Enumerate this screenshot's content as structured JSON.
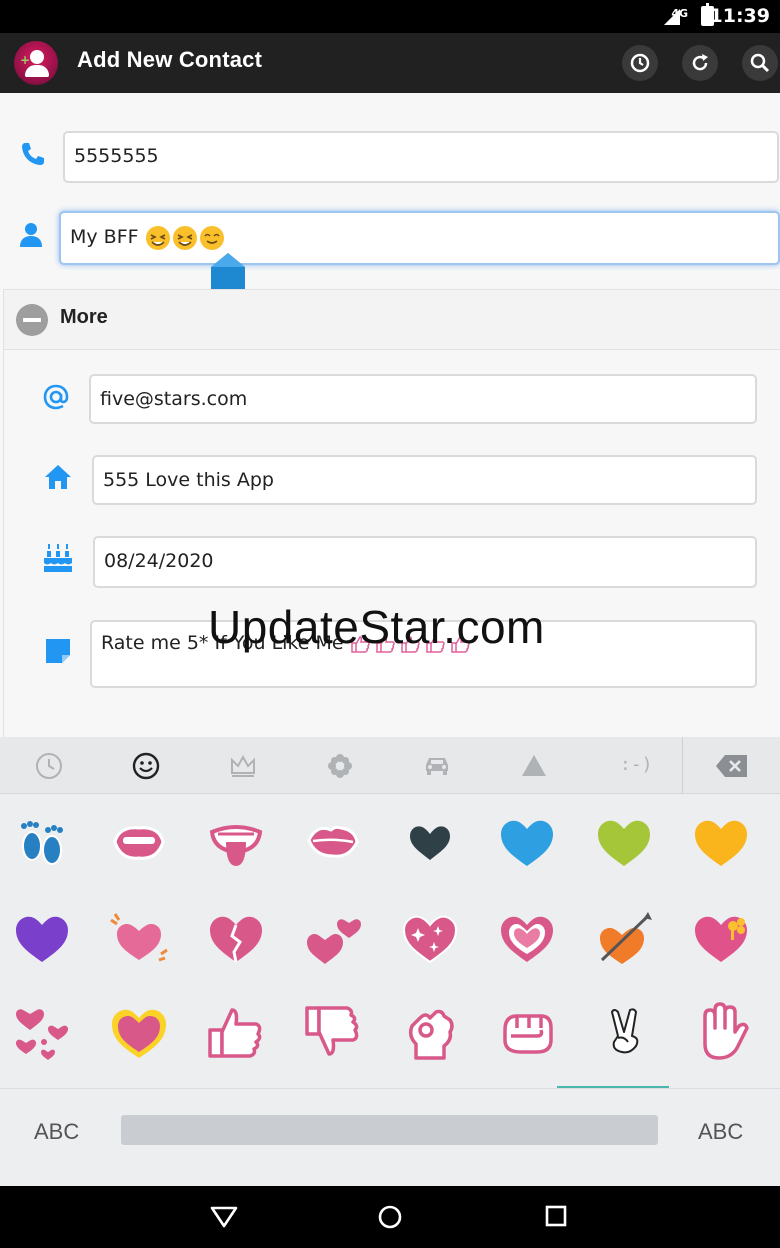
{
  "status_bar": {
    "network": "4G",
    "time": "11:39"
  },
  "app_bar": {
    "title": "Add New Contact",
    "actions": [
      "history-icon",
      "refresh-icon",
      "search-icon"
    ]
  },
  "form": {
    "phone": {
      "icon": "phone-icon",
      "value": "5555555"
    },
    "name": {
      "icon": "person-icon",
      "value": "My BFF",
      "emoji_count": 3
    },
    "more_section": {
      "label": "More",
      "email": {
        "icon": "at-icon",
        "value": "five@stars.com"
      },
      "address": {
        "icon": "home-icon",
        "value": "555 Love this App"
      },
      "birthday": {
        "icon": "cake-icon",
        "value": "08/24/2020"
      },
      "note": {
        "icon": "note-icon",
        "value": "Rate me 5* If You Like Me"
      }
    }
  },
  "watermark": "UpdateStar.com",
  "keyboard": {
    "tabs": [
      "recent-icon",
      "smiley-icon",
      "crown-icon",
      "flower-icon",
      "car-icon",
      "triangle-icon",
      ":-)",
      "backspace-icon"
    ],
    "active_tab": "smiley-icon",
    "emojis": [
      "footprints",
      "mouth",
      "tongue",
      "kiss-mark",
      "black-heart",
      "blue-heart",
      "green-heart",
      "yellow-heart",
      "purple-heart",
      "beating-heart",
      "broken-heart",
      "two-hearts",
      "sparkling-heart",
      "growing-heart",
      "heart-with-arrow",
      "heart-with-ribbon",
      "revolving-hearts",
      "heart-decoration",
      "thumbs-up",
      "thumbs-down",
      "ok-hand",
      "fist",
      "victory-hand",
      "raised-hand"
    ],
    "left_label": "ABC",
    "right_label": "ABC"
  },
  "colors": {
    "accent": "#2196f3",
    "pink": "#d9588a",
    "teal": "#4db6ac"
  }
}
